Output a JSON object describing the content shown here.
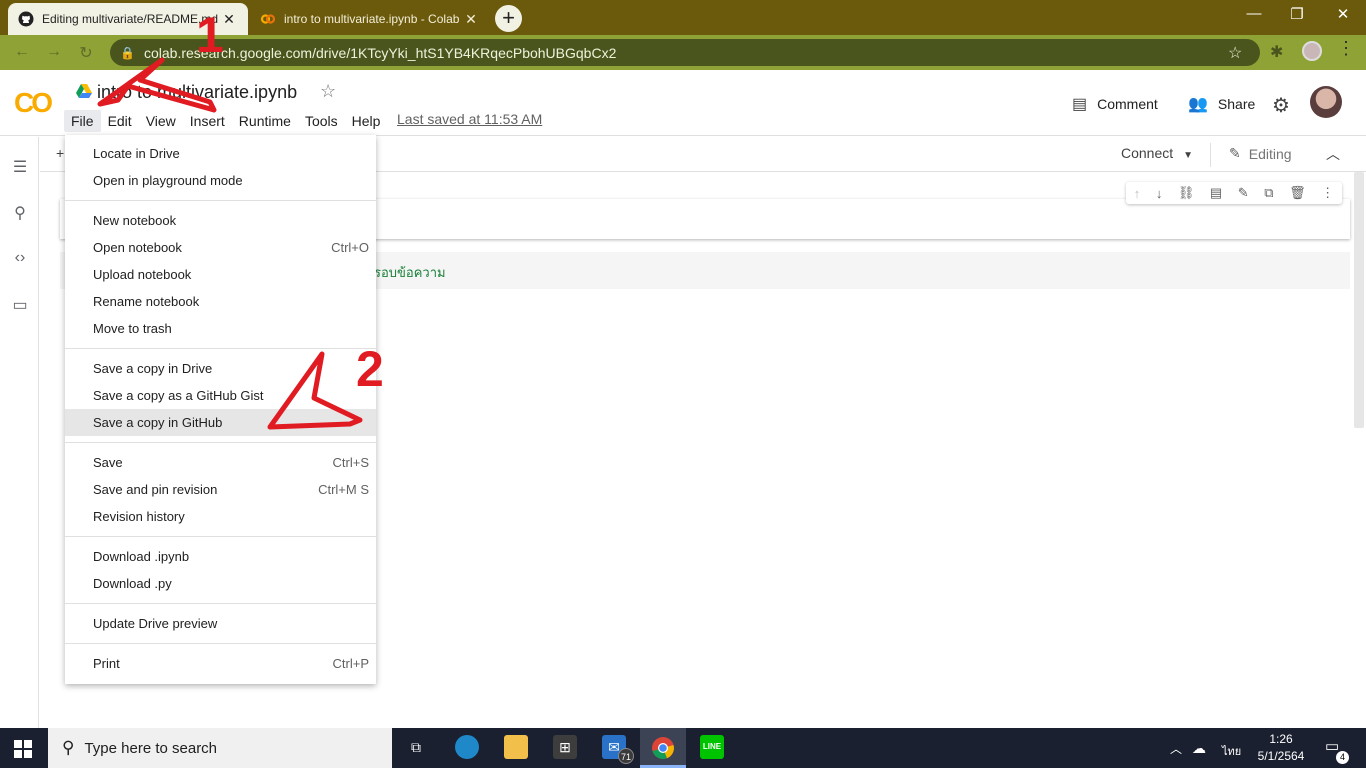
{
  "browser": {
    "tabs": [
      {
        "title": "Editing multivariate/README.md",
        "close": "✕",
        "active": true
      },
      {
        "title": "intro to multivariate.ipynb - Colab",
        "close": "✕",
        "active": false
      }
    ],
    "new_tab": "+",
    "window_controls": {
      "minimize": "—",
      "maximize": "❐",
      "close": "✕"
    },
    "url": "colab.research.google.com/drive/1KTcyYki_htS1YB4KRqecPbohUBGqbCx2",
    "nav": {
      "back": "←",
      "forward": "→",
      "reload": "↻"
    }
  },
  "colab": {
    "logo": "CO",
    "notebook_title": "intro to multivariate.ipynb",
    "menus": [
      "File",
      "Edit",
      "View",
      "Insert",
      "Runtime",
      "Tools",
      "Help"
    ],
    "open_menu": "File",
    "last_saved": "Last saved at 11:53 AM",
    "comment_label": "Comment",
    "share_label": "Share",
    "toolbar": {
      "add": "+",
      "connect": "Connect",
      "editing": "Editing"
    },
    "cell_text": "รอบข้อความ"
  },
  "file_menu": {
    "groups": [
      [
        {
          "label": "Locate in Drive",
          "shortcut": ""
        },
        {
          "label": "Open in playground mode",
          "shortcut": ""
        }
      ],
      [
        {
          "label": "New notebook",
          "shortcut": ""
        },
        {
          "label": "Open notebook",
          "shortcut": "Ctrl+O"
        },
        {
          "label": "Upload notebook",
          "shortcut": ""
        },
        {
          "label": "Rename notebook",
          "shortcut": ""
        },
        {
          "label": "Move to trash",
          "shortcut": ""
        }
      ],
      [
        {
          "label": "Save a copy in Drive",
          "shortcut": ""
        },
        {
          "label": "Save a copy as a GitHub Gist",
          "shortcut": ""
        },
        {
          "label": "Save a copy in GitHub",
          "shortcut": "",
          "highlighted": true
        }
      ],
      [
        {
          "label": "Save",
          "shortcut": "Ctrl+S"
        },
        {
          "label": "Save and pin revision",
          "shortcut": "Ctrl+M S"
        },
        {
          "label": "Revision history",
          "shortcut": ""
        }
      ],
      [
        {
          "label": "Download .ipynb",
          "shortcut": ""
        },
        {
          "label": "Download .py",
          "shortcut": ""
        }
      ],
      [
        {
          "label": "Update Drive preview",
          "shortcut": ""
        }
      ],
      [
        {
          "label": "Print",
          "shortcut": "Ctrl+P"
        }
      ]
    ]
  },
  "annotations": {
    "step1": "1",
    "step2": "2",
    "color": "#e11b22"
  },
  "taskbar": {
    "search_placeholder": "Type here to search",
    "mail_badge": "71",
    "language": "ไทย",
    "time": "1:26",
    "date": "5/1/2564",
    "notification_count": "4"
  }
}
